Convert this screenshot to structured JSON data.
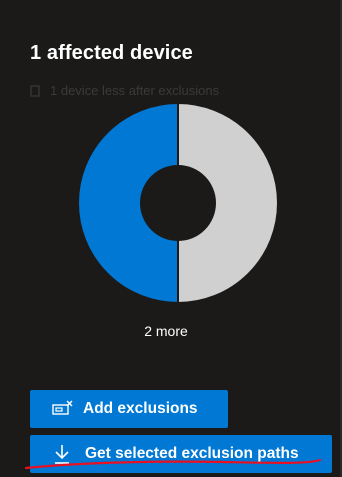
{
  "card": {
    "title": "1 affected device",
    "subtitle": "1 device less after exclusions",
    "subtitle_icon": "info-icon"
  },
  "chart_data": {
    "type": "pie",
    "style": "donut",
    "slices": [
      {
        "color": "#0078d4",
        "value": 1
      },
      {
        "color": "#d0d0d0",
        "value": 1
      }
    ],
    "center_color": "#1b1a19",
    "caption": "2 more"
  },
  "actions": {
    "add_exclusions": {
      "label": "Add exclusions",
      "icon": "add-exclusions-icon"
    },
    "get_paths": {
      "label": "Get selected exclusion paths",
      "icon": "download-icon"
    }
  },
  "colors": {
    "background": "#1b1a19",
    "accent": "#0078d4",
    "annotation": "#e81123"
  }
}
